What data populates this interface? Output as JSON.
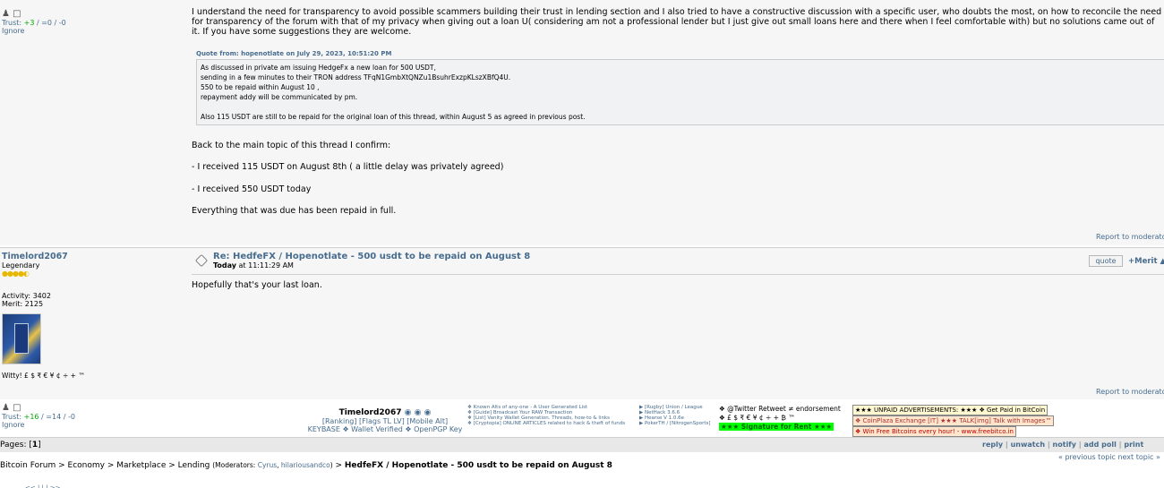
{
  "post1": {
    "trust_label": "Trust: ",
    "trust_value": "+3",
    "trust_rest": " / =0 / -0",
    "ignore": "Ignore",
    "body_intro": "I understand the need for transparency to avoid possible scammers building their trust in lending section and I also tried to have a constructive discussion with a specific user, who doubts the most, on how to reconcile the need for transparency of the forum with that of my privacy when giving out a loan U( considering am not a professional lender but I just give out small loans here and there  when I feel comfortable with) but no solutions came out of it.  If you have some suggestions they are welcome.",
    "quote_header": "Quote from: hopenotlate on July 29, 2023, 10:51:20 PM",
    "quote_lines": [
      "As discussed in private am issuing HedgeFx a new loan for 500 USDT,",
      "sending in a few minutes to their TRON address TFqN1GmbXtQNZu1BsuhrExzpKLszXBfQ4U.",
      "550 to be repaid within August 10 ,",
      "repayment addy will be communicated by pm.",
      "",
      "Also 115 USDT are still to be repaid for the original loan of this thread, within August 5 as agreed in previous post."
    ],
    "line1": "Back to the main topic of this thread I confirm:",
    "line2": " - I received 115 USDT on August 8th ( a little delay was privately agreed)",
    "line3": " - I received 550 USDT today",
    "line4": "Everything that was due has been repaid in full.",
    "report": "Report to moderator"
  },
  "post2": {
    "username": "Timelord2067",
    "rank": "Legendary",
    "activity": "Activity: 3402",
    "merit_stat": "Merit: 2125",
    "personal_text": "Witty! £ $ ₹ € ¥ ¢ ÷ + ™",
    "trust_label": "Trust: ",
    "trust_value": "+16",
    "trust_rest": " / =14 / -0",
    "ignore": "Ignore",
    "title": "Re: HedfeFX / Hopenotlate - 500 usdt to be repaid on August 8",
    "date_bold": "Today",
    "date_rest": " at 11:11:29 AM",
    "quote_btn": "quote",
    "merit_btn": "+Merit",
    "body": "Hopefully that's your last loan.",
    "report": "Report to moderator",
    "sig_name": "Timelord2067",
    "sig_line2": "[Ranking] [Flags TL LV] [Mobile Alt]",
    "sig_line3": "KEYBASE ❖ Wallet Verified ❖ OpenPGP Key",
    "sig_col2": [
      "❖ Known Alts of any-one - A User Generated List",
      "❖ [Guide] Broadcast Your RAW Transaction",
      "❖ [List] Vanity Wallet Generation. Threads, how-to & links",
      "❖ [Cryptopia] ONLINE ARTICLES related to hack & theft of funds"
    ],
    "sig_col3": [
      "▶ [Rugby] Union / League",
      "▶ NetHack 3.6.6",
      "▶ Hearse V 1.0.6e",
      "▶ PokerTH / [NitrogenSports]"
    ],
    "sig_col4_1": "❖ @Twitter Retweet ≠ endorsement",
    "sig_col4_2": "❖ £ $ ₹ € ¥ ¢ ÷ + ₿ ™",
    "sig_col4_3": "★★★ Signature for Rent ★★★",
    "ad1": "★★★ UNPAID ADVERTISEMENTS: ★★★ ❖ Get Paid in BitCoin",
    "ad2": "❖ CoinPlaza Exchange [IT]  ★★★ TALK[img] Talk with Images™",
    "ad3": "❖ Win Free Bitcoins every hour! - www.freebitco.in"
  },
  "footer": {
    "pages_label": "Pages: [",
    "pages_current": "1",
    "pages_end": "]",
    "actions": [
      "reply",
      "unwatch",
      "notify",
      "add poll",
      "print"
    ],
    "prev_next": "« previous topic next topic »",
    "breadcrumb_start": "Bitcoin Forum > Economy > Marketplace > Lending ",
    "moderators_label": "(Moderators: ",
    "mod1": "Cyrus",
    "mod2": "hilariousandco",
    "moderators_end": ")",
    "breadcrumb_sep": " > ",
    "topic": "HedfeFX / Hopenotlate - 500 usdt to be repaid on August 8",
    "jump": "<< | | | >>"
  }
}
